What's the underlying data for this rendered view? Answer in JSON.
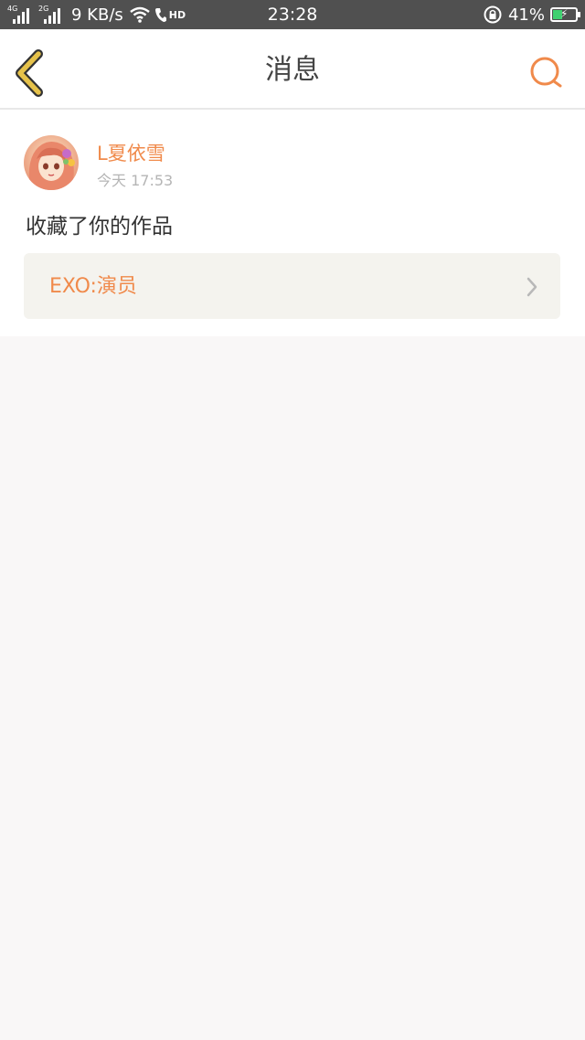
{
  "status_bar": {
    "signal1_label": "4G",
    "signal2_label": "2G",
    "net_speed": "9 KB/s",
    "hd_label": "HD",
    "time": "23:28",
    "battery_percent": "41%",
    "battery_level": 0.41
  },
  "header": {
    "title": "消息",
    "back_icon": "chevron-left-icon",
    "search_icon": "search-icon"
  },
  "message": {
    "username": "L夏依雪",
    "time": "今天 17:53",
    "action": "收藏了你的作品",
    "work_title": "EXO:演员"
  },
  "colors": {
    "accent": "#f08a4b",
    "back_icon": "#e6c24a",
    "status_bar": "#505050",
    "page_bg": "#f9f7f7"
  }
}
